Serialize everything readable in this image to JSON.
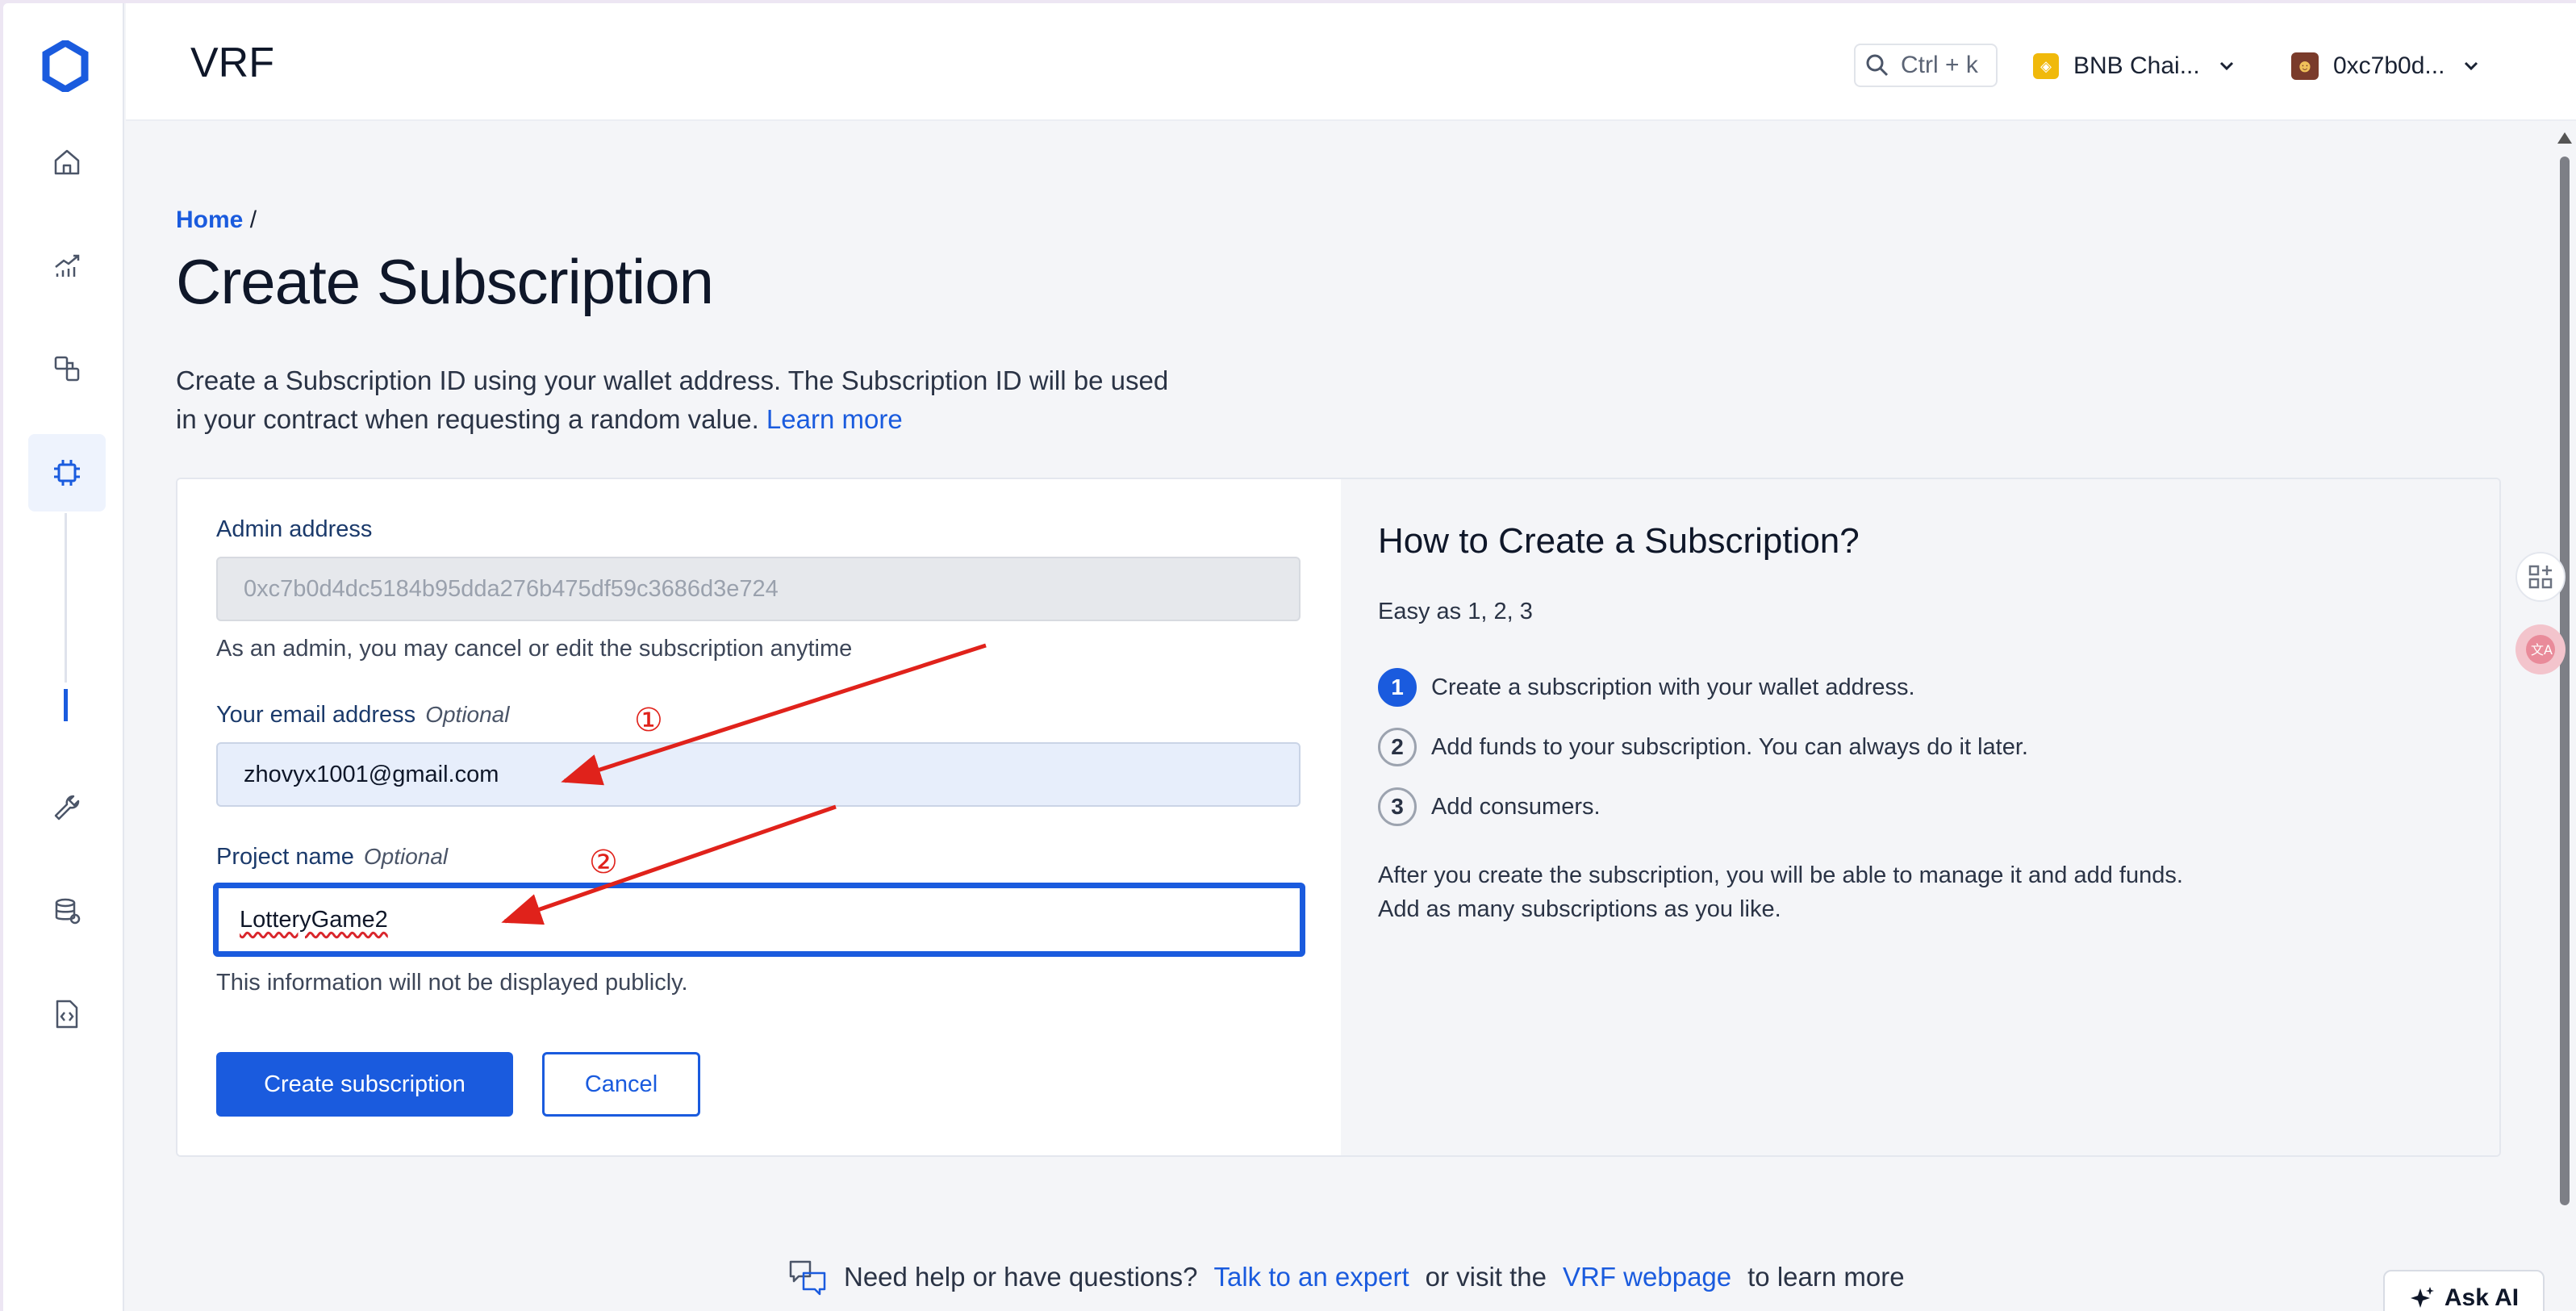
{
  "header": {
    "title": "VRF",
    "search_shortcut": "Ctrl + k",
    "network": "BNB Chai...",
    "wallet": "0xc7b0d..."
  },
  "sidebar": {
    "items": [
      {
        "name": "home",
        "icon": "home-icon"
      },
      {
        "name": "data-feeds",
        "icon": "chart-icon"
      },
      {
        "name": "ccip",
        "icon": "shapes-icon"
      },
      {
        "name": "vrf",
        "icon": "chip-icon",
        "active": true
      },
      {
        "name": "automation",
        "icon": "wrench-icon"
      },
      {
        "name": "data-streams",
        "icon": "database-icon"
      },
      {
        "name": "functions",
        "icon": "code-icon"
      }
    ]
  },
  "breadcrumb": {
    "home": "Home",
    "separator": "/"
  },
  "page": {
    "title": "Create Subscription",
    "intro_line1": "Create a Subscription ID using your wallet address. The Subscription ID will be used",
    "intro_line2": "in your contract when requesting a random value.",
    "learn_more": "Learn more"
  },
  "form": {
    "admin_label": "Admin address",
    "admin_value": "0xc7b0d4dc5184b95dda276b475df59c3686d3e724",
    "admin_helper": "As an admin, you may cancel or edit the subscription anytime",
    "email_label": "Your email address",
    "email_optional": "Optional",
    "email_value": "zhovyx1001@gmail.com",
    "project_label": "Project name",
    "project_optional": "Optional",
    "project_value": "LotteryGame2",
    "project_helper": "This information will not be displayed publicly.",
    "submit": "Create subscription",
    "cancel": "Cancel"
  },
  "howto": {
    "title": "How to Create a Subscription?",
    "subtitle": "Easy as 1, 2, 3",
    "steps": [
      {
        "num": "1",
        "text": "Create a subscription with your wallet address."
      },
      {
        "num": "2",
        "text": "Add funds to your subscription. You can always do it later."
      },
      {
        "num": "3",
        "text": "Add consumers."
      }
    ],
    "note_line1": "After you create the subscription, you will be able to manage it and add funds.",
    "note_line2": "Add as many subscriptions as you like."
  },
  "annotations": {
    "marker1": "①",
    "marker2": "②",
    "color": "#e0221b"
  },
  "footer": {
    "prefix": "Need help or have questions?",
    "expert_link": "Talk to an expert",
    "middle": "or visit the",
    "vrf_link": "VRF webpage",
    "suffix": "to learn more"
  },
  "ask_ai": "Ask AI",
  "colors": {
    "accent": "#1a5bde",
    "annotation": "#e0221b"
  }
}
